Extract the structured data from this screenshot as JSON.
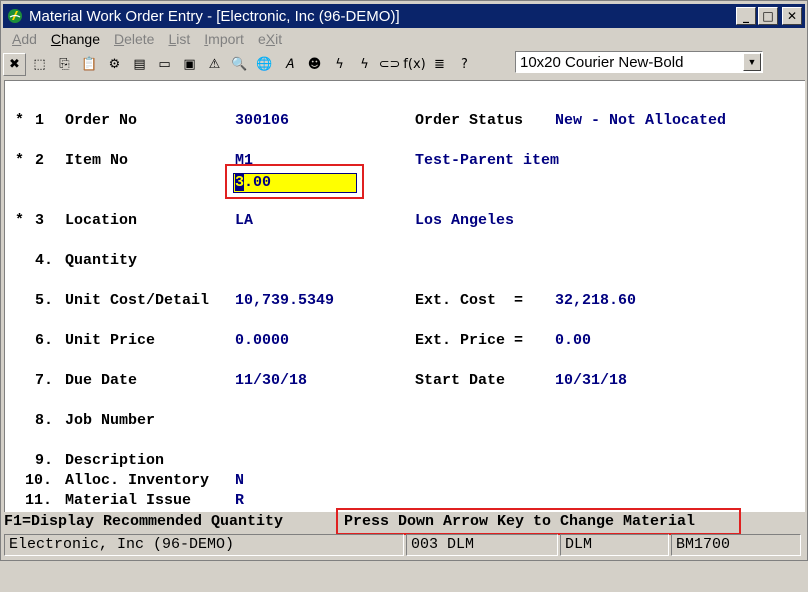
{
  "window": {
    "title": "Material Work Order Entry - [Electronic, Inc (96-DEMO)]",
    "minimize": "_",
    "maximize": "□",
    "close": "✕"
  },
  "menu": [
    {
      "label": "Add",
      "enabled": false
    },
    {
      "label": "Change",
      "enabled": true
    },
    {
      "label": "Delete",
      "enabled": false
    },
    {
      "label": "List",
      "enabled": false
    },
    {
      "label": "Import",
      "enabled": false
    },
    {
      "label": "eXit",
      "enabled": false
    }
  ],
  "toolbar": {
    "icons": [
      "close-icon",
      "select-icon",
      "copy-icon",
      "paste-icon",
      "settings-icon",
      "properties-icon",
      "notes-icon",
      "print-preview-icon",
      "alert-icon",
      "search-icon",
      "globe-icon",
      "font-icon",
      "portrait-icon",
      "lightning-icon",
      "lightning-doc-icon",
      "link-icon",
      "function-icon",
      "list-icon",
      "help-icon"
    ],
    "glyphs": [
      "✖",
      "⬚",
      "⎘",
      "📋",
      "⚙",
      "▤",
      "▭",
      "▣",
      "⚠",
      "🔍",
      "🌐",
      "𝐴",
      "☻",
      "ϟ",
      "ϟ",
      "⊂⊃",
      "f(x)",
      "≣",
      "?"
    ],
    "font_select": "10x20 Courier New-Bold"
  },
  "form": {
    "fields": [
      {
        "marker": "*",
        "num": "1",
        "label": "Order No",
        "value": "300106",
        "desc_label": "Order Status",
        "desc_value": "New - Not Allocated"
      },
      {
        "marker": "*",
        "num": "2",
        "label": "Item No",
        "value": "M1",
        "desc_value": "Test-Parent item"
      },
      {
        "marker": "*",
        "num": "3",
        "label": "Location",
        "value": "LA",
        "desc_value": "Los Angeles"
      },
      {
        "num": "4.",
        "label": "Quantity"
      },
      {
        "num": "5.",
        "label": "Unit Cost/Detail",
        "value": "10,739.5349",
        "desc_label": "Ext. Cost  =",
        "desc_value": "32,218.60"
      },
      {
        "num": "6.",
        "label": "Unit Price",
        "value": "0.0000",
        "desc_label": "Ext. Price =",
        "desc_value": "0.00"
      },
      {
        "num": "7.",
        "label": "Due Date",
        "value": "11/30/18",
        "desc_label": "Start Date",
        "desc_value": "10/31/18"
      },
      {
        "num": "8.",
        "label": "Job Number"
      },
      {
        "num": "9.",
        "label": "Description"
      },
      {
        "num": "10.",
        "label": "Alloc. Inventory",
        "value": "N"
      },
      {
        "num": "11.",
        "label": "Material Issue",
        "value": "R"
      }
    ],
    "quantity": {
      "cursor_char": "3",
      "rest": ".00"
    }
  },
  "hints": {
    "f1": "F1=Display Recommended Quantity",
    "down_arrow": "Press Down Arrow Key to Change Material"
  },
  "status": {
    "company": "Electronic, Inc (96-DEMO)",
    "user_code": "003 DLM",
    "user": "DLM",
    "program": "BM1700"
  },
  "colors": {
    "label": "#000000",
    "value": "#000080",
    "title_bar": "#0a246a",
    "highlight_box": "#e02020",
    "input_bg": "#ffff00"
  }
}
